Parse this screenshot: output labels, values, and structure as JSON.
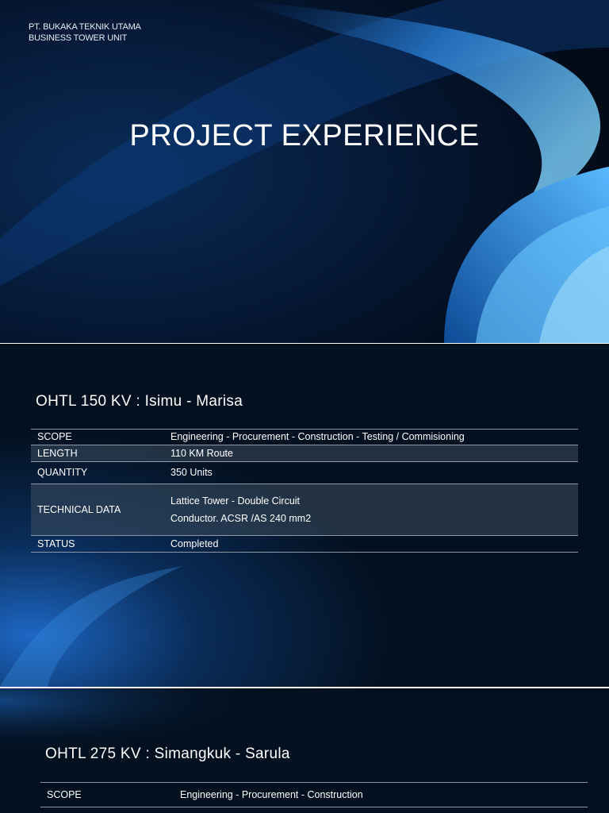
{
  "slide1": {
    "company": [
      "PT. BUKAKA TEKNIK UTAMA",
      "BUSINESS TOWER UNIT"
    ],
    "title": "PROJECT EXPERIENCE"
  },
  "project1": {
    "title": "OHTL 150 KV :  Isimu - Marisa",
    "rows": {
      "scope": {
        "label": "SCOPE",
        "value": "Engineering - Procurement - Construction - Testing / Commisioning"
      },
      "length": {
        "label": "LENGTH",
        "value": "110  KM Route"
      },
      "quantity": {
        "label": "QUANTITY",
        "value": "350  Units"
      },
      "technical": {
        "label": "TECHNICAL DATA",
        "values": [
          "Lattice Tower - Double Circuit",
          "Conductor.  ACSR /AS 240 mm2"
        ]
      },
      "status": {
        "label": "STATUS",
        "value": "Completed"
      }
    }
  },
  "project2": {
    "title": "OHTL 275 KV :  Simangkuk - Sarula",
    "rows": {
      "scope": {
        "label": "SCOPE",
        "value": "Engineering - Procurement - Construction"
      }
    }
  },
  "colors": {
    "background": "#03101f",
    "swirl": "#2f8fe6",
    "text": "#ffffff"
  }
}
